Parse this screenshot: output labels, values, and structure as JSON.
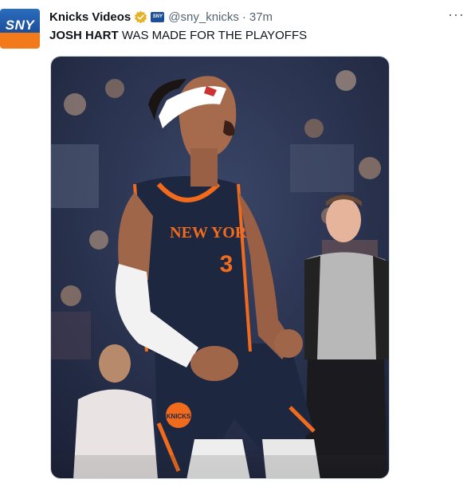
{
  "account": {
    "avatar_text": "SNY",
    "display_name": "Knicks Videos",
    "affiliate_badge_text": "SNY",
    "handle": "@sny_knicks",
    "separator": "·",
    "time": "37m"
  },
  "more_menu": {
    "icon": "more-horizontal-icon",
    "label": "···"
  },
  "tweet": {
    "text_bold": "JOSH HART",
    "text_rest": " WAS MADE FOR THE PLAYOFFS"
  },
  "photo": {
    "jersey_text": "NEW YORK",
    "jersey_number": "3",
    "shorts_logo_text": "KNICKS",
    "colors": {
      "jersey": "#1d2740",
      "orange": "#f26b1d",
      "crowd": "#2b3550"
    }
  },
  "colors": {
    "verified": "#e8b12a",
    "secondary_text": "#536471"
  }
}
